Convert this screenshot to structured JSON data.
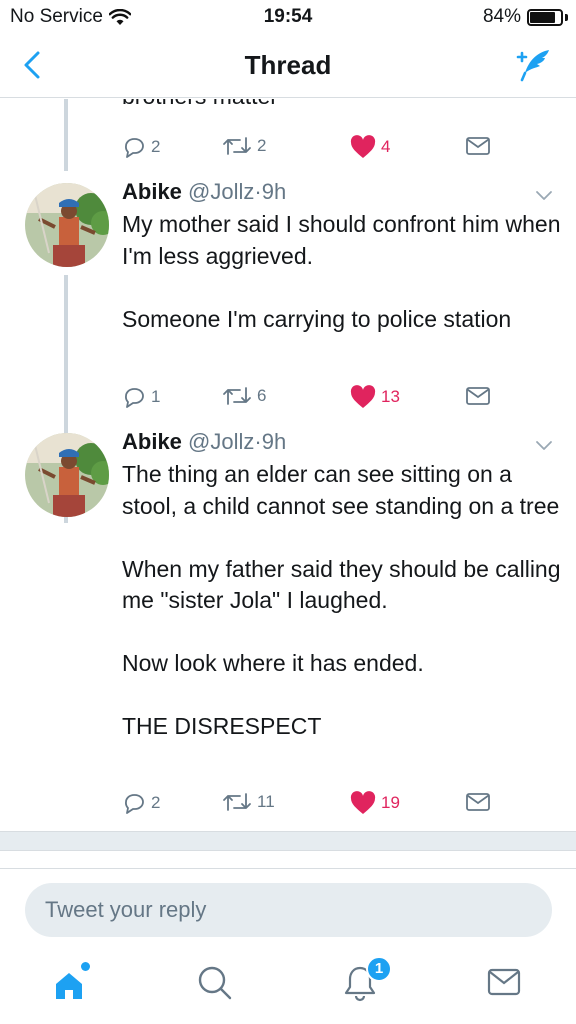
{
  "status_bar": {
    "carrier": "No Service",
    "time": "19:54",
    "battery": "84%",
    "battery_level": 0.84
  },
  "nav": {
    "title": "Thread",
    "back_icon": "chevron-left-icon",
    "compose_icon": "compose-tweet-icon"
  },
  "partial_tweet": {
    "text_fragment": "brothers matter",
    "actions": {
      "replies": "2",
      "retweets": "2",
      "likes": "4"
    }
  },
  "tweets": [
    {
      "name": "Abike",
      "handle": "@Jollz",
      "separator": "·",
      "time": "9h",
      "text": "My mother said I should confront him when I'm less aggrieved.\n\nSomeone I'm carrying to police station",
      "actions": {
        "replies": "1",
        "retweets": "6",
        "likes": "13"
      }
    },
    {
      "name": "Abike",
      "handle": "@Jollz",
      "separator": "·",
      "time": "9h",
      "text": "The thing an elder can see sitting on a stool, a child cannot see standing on a tree\n\nWhen my father said they should be calling me \"sister Jola\" I laughed.\n\nNow look where it has ended.\n\nTHE DISRESPECT",
      "actions": {
        "replies": "2",
        "retweets": "11",
        "likes": "19"
      }
    }
  ],
  "reply": {
    "placeholder": "Tweet your reply"
  },
  "tab_bar": {
    "notifications_badge": "1",
    "icons": [
      "home-icon",
      "search-icon",
      "notifications-icon",
      "messages-icon"
    ]
  },
  "colors": {
    "accent": "#1da1f2",
    "like": "#e0245e",
    "muted": "#657786",
    "text": "#14171a",
    "divider": "#e6ecf0"
  }
}
